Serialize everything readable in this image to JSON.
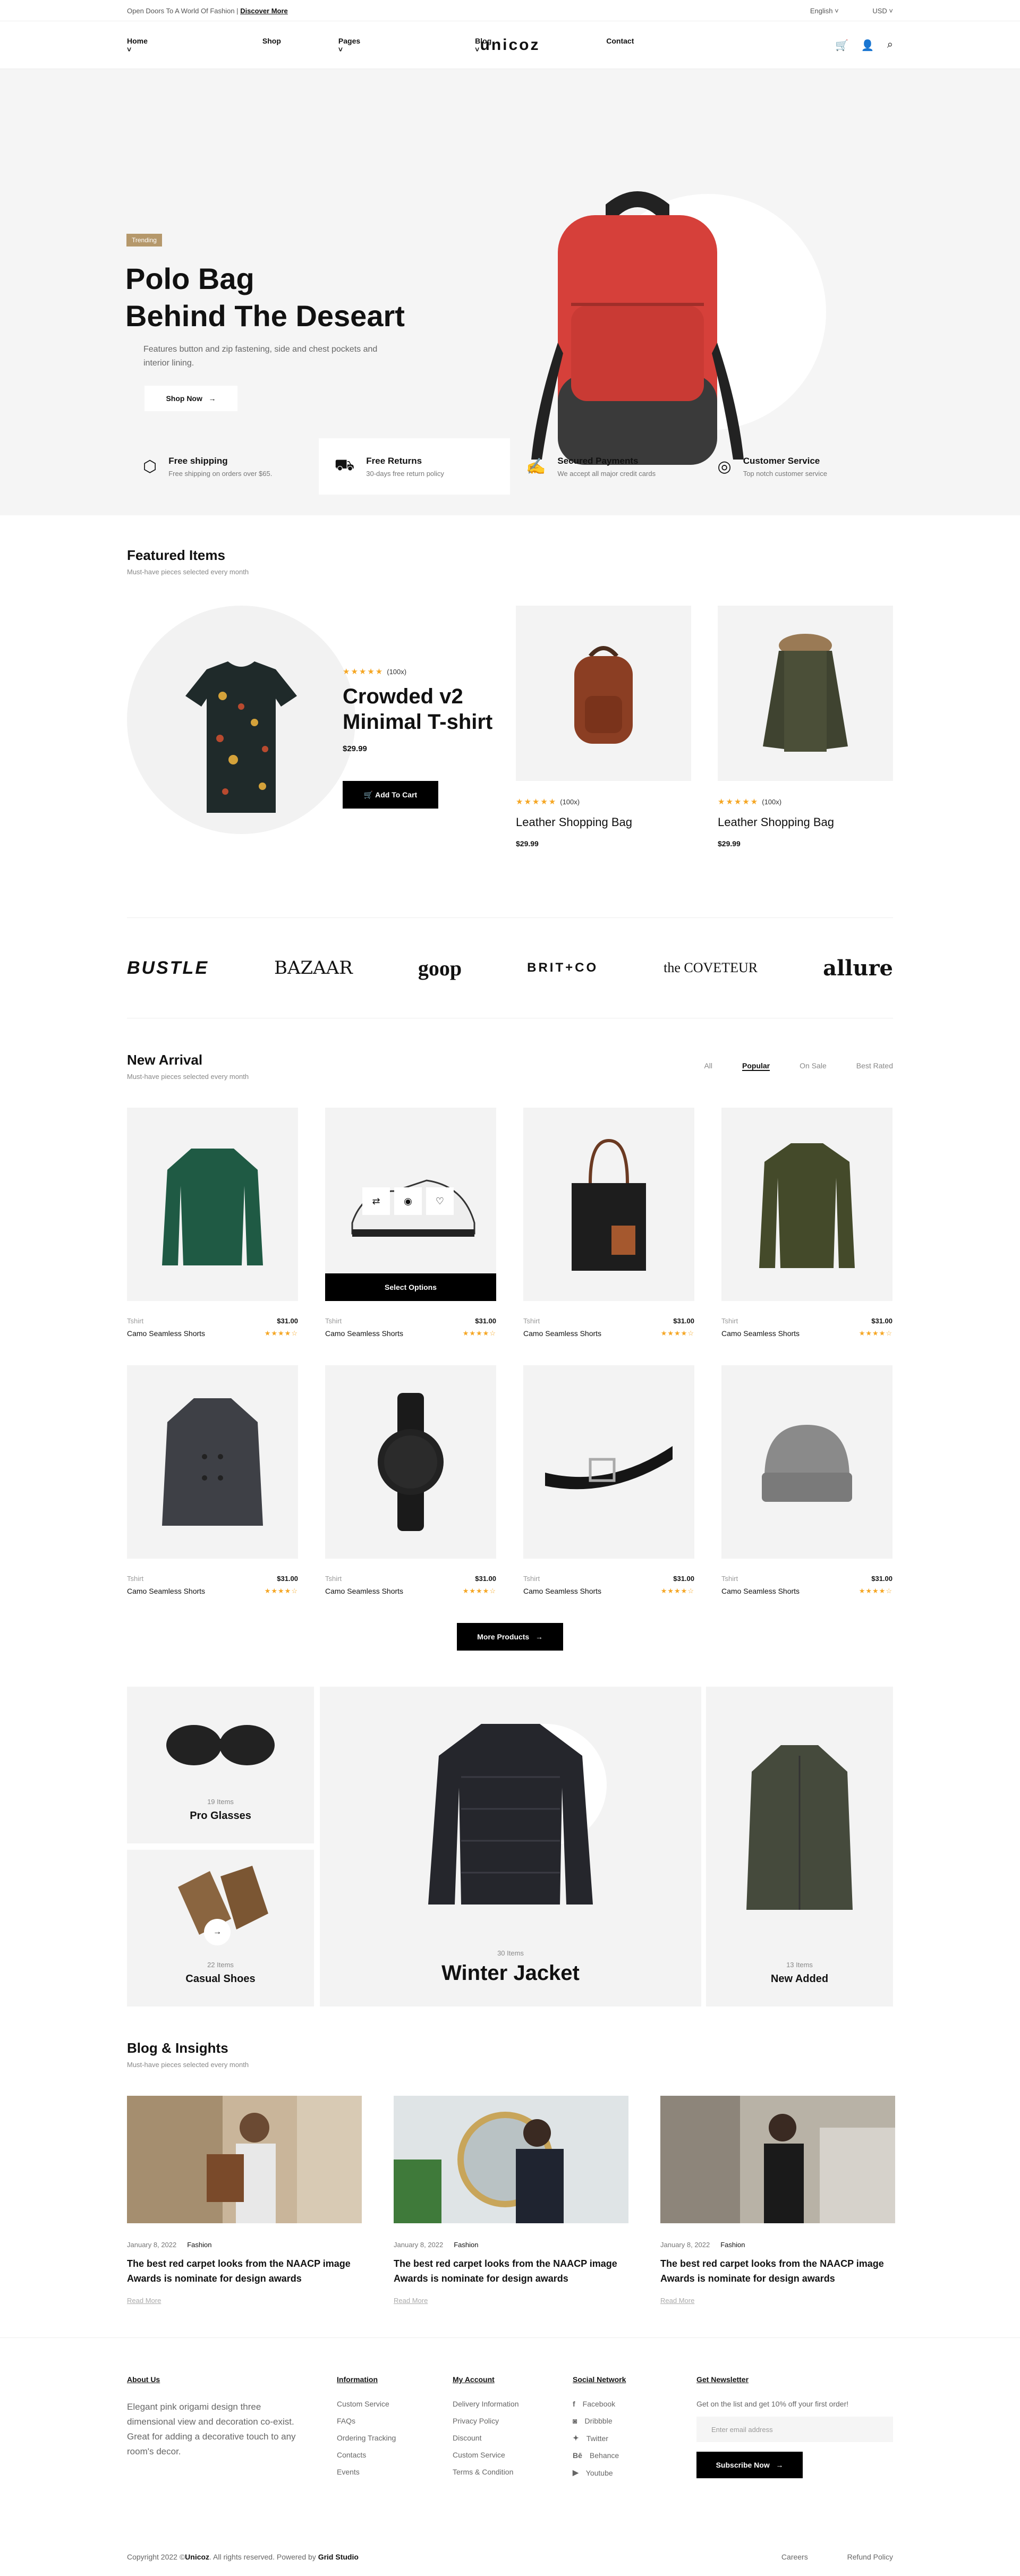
{
  "topbar": {
    "promo": "Open Doors To A World Of Fashion |",
    "promo_link": "Discover More",
    "language": "English",
    "currency": "USD"
  },
  "header": {
    "logo": "unicoz",
    "nav": [
      "Home",
      "Shop",
      "Pages",
      "Blog",
      "Contact"
    ]
  },
  "hero": {
    "badge": "Trending",
    "title_line1": "Polo Bag",
    "title_line2": "Behind The Deseart",
    "desc": "Features button and zip fastening, side and chest pockets and interior lining.",
    "cta": "Shop Now"
  },
  "features": [
    {
      "title": "Free shipping",
      "sub": "Free shipping on orders over $65.",
      "icon": "box-icon"
    },
    {
      "title": "Free Returns",
      "sub": "30-days free return policy",
      "icon": "truck-icon"
    },
    {
      "title": "Secured Payments",
      "sub": "We accept all major credit cards",
      "icon": "card-icon"
    },
    {
      "title": "Customer Service",
      "sub": "Top notch customer service",
      "icon": "support-24-icon"
    }
  ],
  "featured": {
    "title": "Featured Items",
    "sub": "Must-have pieces selected every month",
    "big": {
      "reviews": "(100x)",
      "name_line1": "Crowded v2",
      "name_line2": "Minimal T-shirt",
      "price": "$29.99",
      "cta": "Add To Cart"
    },
    "cards": [
      {
        "reviews": "(100x)",
        "name": "Leather Shopping Bag",
        "price": "$29.99"
      },
      {
        "reviews": "(100x)",
        "name": "Leather Shopping Bag",
        "price": "$29.99"
      }
    ]
  },
  "brands": [
    "BUSTLE",
    "BAZAAR",
    "goop",
    "BRIT+CO",
    "the COVETEUR",
    "allure"
  ],
  "arrival": {
    "title": "New Arrival",
    "sub": "Must-have pieces selected every month",
    "tabs": [
      "All",
      "Popular",
      "On Sale",
      "Best Rated"
    ],
    "active_tab": "Popular",
    "select_options": "Select Options",
    "products": [
      {
        "cat": "Tshirt",
        "name": "Camo Seamless Shorts",
        "price": "$31.00",
        "rating": 4
      },
      {
        "cat": "Tshirt",
        "name": "Camo Seamless Shorts",
        "price": "$31.00",
        "rating": 4
      },
      {
        "cat": "Tshirt",
        "name": "Camo Seamless Shorts",
        "price": "$31.00",
        "rating": 4
      },
      {
        "cat": "Tshirt",
        "name": "Camo Seamless Shorts",
        "price": "$31.00",
        "rating": 4
      },
      {
        "cat": "Tshirt",
        "name": "Camo Seamless Shorts",
        "price": "$31.00",
        "rating": 4
      },
      {
        "cat": "Tshirt",
        "name": "Camo Seamless Shorts",
        "price": "$31.00",
        "rating": 4
      },
      {
        "cat": "Tshirt",
        "name": "Camo Seamless Shorts",
        "price": "$31.00",
        "rating": 4
      },
      {
        "cat": "Tshirt",
        "name": "Camo Seamless Shorts",
        "price": "$31.00",
        "rating": 4
      }
    ],
    "more": "More Products"
  },
  "categories": [
    {
      "count": "19 Items",
      "name": "Pro Glasses"
    },
    {
      "count": "22 Items",
      "name": "Casual Shoes"
    },
    {
      "count": "30 Items",
      "name": "Winter Jacket"
    },
    {
      "count": "13 Items",
      "name": "New Added"
    }
  ],
  "blog": {
    "title": "Blog & Insights",
    "sub": "Must-have pieces selected every month",
    "posts": [
      {
        "date": "January 8, 2022",
        "cat": "Fashion",
        "title": "The best red carpet looks from the NAACP image Awards is nominate for design awards",
        "more": "Read More"
      },
      {
        "date": "January 8, 2022",
        "cat": "Fashion",
        "title": "The best red carpet looks from the NAACP image Awards is nominate for design awards",
        "more": "Read More"
      },
      {
        "date": "January 8, 2022",
        "cat": "Fashion",
        "title": "The best red carpet looks from the NAACP image Awards is nominate for design awards",
        "more": "Read More"
      }
    ]
  },
  "footer": {
    "about_title": "About Us",
    "about": "Elegant pink origami design three dimensional view and decoration co-exist. Great for adding a decorative touch to any room's decor.",
    "info_title": "Information",
    "info": [
      "Custom Service",
      "FAQs",
      "Ordering Tracking",
      "Contacts",
      "Events"
    ],
    "account_title": "My Account",
    "account": [
      "Delivery Information",
      "Privacy Policy",
      "Discount",
      "Custom Service",
      "Terms & Condition"
    ],
    "social_title": "Social Network",
    "social": [
      "Facebook",
      "Dribbble",
      "Twitter",
      "Behance",
      "Youtube"
    ],
    "news_title": "Get Newsletter",
    "news_sub": "Get on the list and get 10% off your first order!",
    "email_placeholder": "Enter email address",
    "subscribe": "Subscribe Now",
    "copyright_pre": "Copyright 2022 ©",
    "copyright_brand": "Unicoz",
    "copyright_mid": ". All rights reserved. Powered by",
    "copyright_studio": "Grid Studio",
    "links": [
      "Careers",
      "Refund Policy"
    ]
  }
}
